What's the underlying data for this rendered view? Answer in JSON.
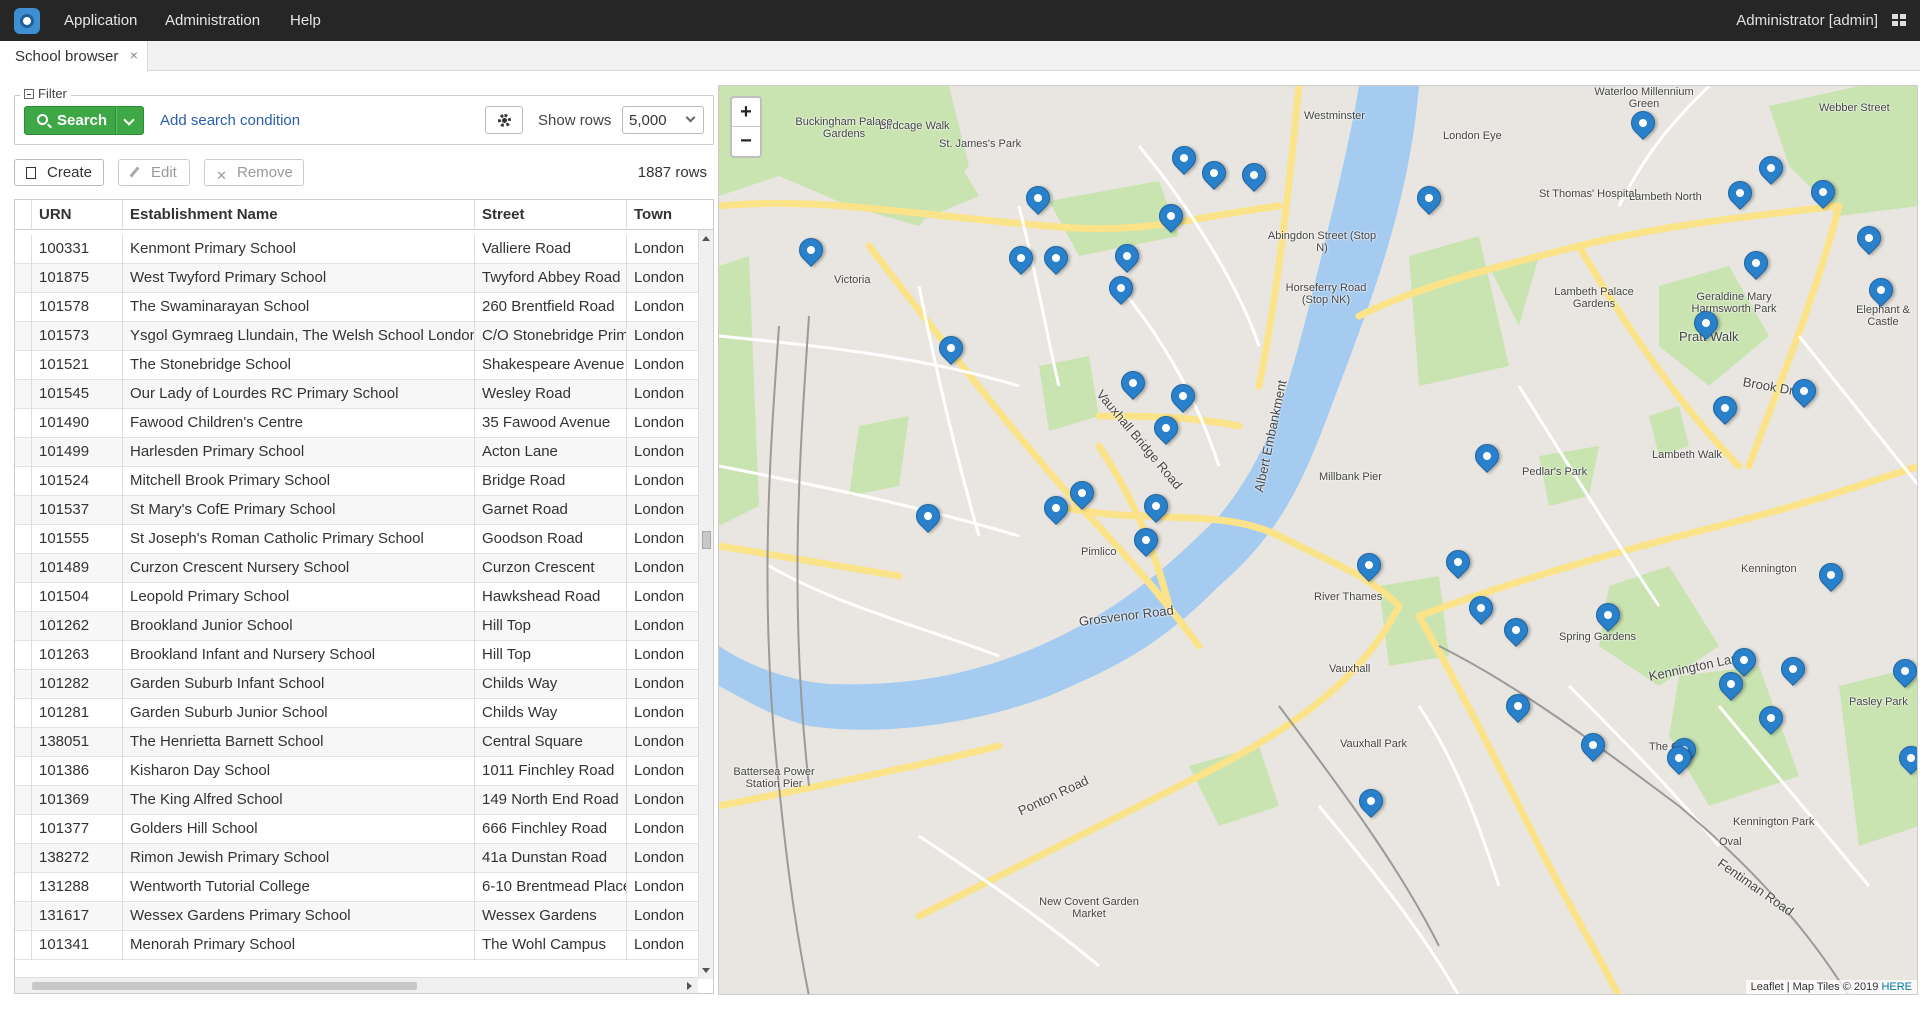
{
  "menubar": {
    "items": [
      "Application",
      "Administration",
      "Help"
    ],
    "user": "Administrator [admin]"
  },
  "tabs": [
    {
      "label": "School browser",
      "close": "×"
    }
  ],
  "filter": {
    "legend": "Filter",
    "search_label": "Search",
    "add_condition": "Add search condition",
    "show_rows_label": "Show rows",
    "show_rows_value": "5,000"
  },
  "actions": {
    "create": "Create",
    "edit": "Edit",
    "remove": "Remove",
    "row_count": "1887 rows"
  },
  "table": {
    "columns": [
      "URN",
      "Establishment Name",
      "Street",
      "Town"
    ],
    "rows": [
      [
        "100331",
        "Kenmont Primary School",
        "Valliere Road",
        "London"
      ],
      [
        "101875",
        "West Twyford Primary School",
        "Twyford Abbey Road",
        "London"
      ],
      [
        "101578",
        "The Swaminarayan School",
        "260 Brentfield Road",
        "London"
      ],
      [
        "101573",
        "Ysgol Gymraeg Llundain, The Welsh School London",
        "C/O Stonebridge Prima",
        "London"
      ],
      [
        "101521",
        "The Stonebridge School",
        "Shakespeare Avenue",
        "London"
      ],
      [
        "101545",
        "Our Lady of Lourdes RC Primary School",
        "Wesley Road",
        "London"
      ],
      [
        "101490",
        "Fawood Children's Centre",
        "35 Fawood Avenue",
        "London"
      ],
      [
        "101499",
        "Harlesden Primary School",
        "Acton Lane",
        "London"
      ],
      [
        "101524",
        "Mitchell Brook Primary School",
        "Bridge Road",
        "London"
      ],
      [
        "101537",
        "St Mary's CofE Primary School",
        "Garnet Road",
        "London"
      ],
      [
        "101555",
        "St Joseph's Roman Catholic Primary School",
        "Goodson Road",
        "London"
      ],
      [
        "101489",
        "Curzon Crescent Nursery School",
        "Curzon Crescent",
        "London"
      ],
      [
        "101504",
        "Leopold Primary School",
        "Hawkshead Road",
        "London"
      ],
      [
        "101262",
        "Brookland Junior School",
        "Hill Top",
        "London"
      ],
      [
        "101263",
        "Brookland Infant and Nursery School",
        "Hill Top",
        "London"
      ],
      [
        "101282",
        "Garden Suburb Infant School",
        "Childs Way",
        "London"
      ],
      [
        "101281",
        "Garden Suburb Junior School",
        "Childs Way",
        "London"
      ],
      [
        "138051",
        "The Henrietta Barnett School",
        "Central Square",
        "London"
      ],
      [
        "101386",
        "Kisharon Day School",
        "1011 Finchley Road",
        "London"
      ],
      [
        "101369",
        "The King Alfred School",
        "149 North End Road",
        "London"
      ],
      [
        "101377",
        "Golders Hill School",
        "666 Finchley Road",
        "London"
      ],
      [
        "138272",
        "Rimon Jewish Primary School",
        "41a Dunstan Road",
        "London"
      ],
      [
        "131288",
        "Wentworth Tutorial College",
        "6-10 Brentmead Place",
        "London"
      ],
      [
        "131617",
        "Wessex Gardens Primary School",
        "Wessex Gardens",
        "London"
      ],
      [
        "101341",
        "Menorah Primary School",
        "The Wohl Campus",
        "London"
      ]
    ]
  },
  "map": {
    "zoom_in": "+",
    "zoom_out": "−",
    "attribution_prefix": "Leaflet | Map Tiles © 2019 ",
    "attribution_link": "HERE",
    "labels": [
      {
        "t": "Westminster"
      },
      {
        "t": "London Eye"
      },
      {
        "t": "Waterloo Millennium Green"
      },
      {
        "t": "St. James's Park"
      },
      {
        "t": "Birdcage Walk"
      },
      {
        "t": "Buckingham Palace Gardens"
      },
      {
        "t": "Victoria"
      },
      {
        "t": "Pimlico"
      },
      {
        "t": "Vauxhall"
      },
      {
        "t": "Kennington"
      },
      {
        "t": "Lambeth North"
      },
      {
        "t": "Millbank Pier"
      },
      {
        "t": "River Thames"
      },
      {
        "t": "Battersea Power Station Pier"
      },
      {
        "t": "The Oval"
      },
      {
        "t": "Oval"
      },
      {
        "t": "Kennington Park"
      },
      {
        "t": "Vauxhall Park"
      },
      {
        "t": "Spring Gardens"
      },
      {
        "t": "Lambeth Palace Gardens"
      },
      {
        "t": "Geraldine Mary Harmsworth Park"
      },
      {
        "t": "Grosvenor Road"
      },
      {
        "t": "Vauxhall Bridge Road"
      },
      {
        "t": "Kennington Lane"
      },
      {
        "t": "Albert Embankment"
      },
      {
        "t": "Brook Drive"
      },
      {
        "t": "Pratt Walk"
      },
      {
        "t": "Fentiman Road"
      },
      {
        "t": "Ponton Road"
      },
      {
        "t": "New Covent Garden Market"
      },
      {
        "t": "St Thomas' Hospital"
      },
      {
        "t": "Horseferry Road (Stop NK)"
      },
      {
        "t": "Abingdon Street (Stop N)"
      },
      {
        "t": "Lambeth Walk"
      },
      {
        "t": "Pedlar's Park"
      },
      {
        "t": "Elephant & Castle"
      },
      {
        "t": "Webber Street"
      },
      {
        "t": "Pasley Park"
      }
    ],
    "markers_count_visible": 49
  }
}
